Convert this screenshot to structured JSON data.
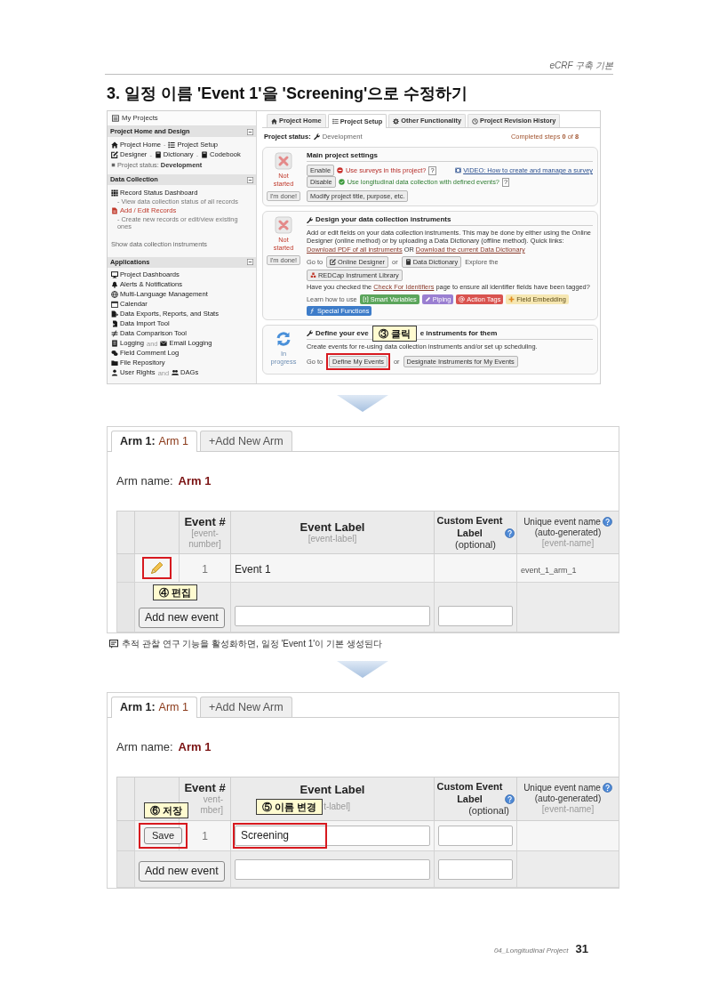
{
  "page_header": {
    "section": "eCRF 구축 기본"
  },
  "title": "3. 일정 이름 'Event 1'을 'Screening'으로 수정하기",
  "project_setup_screen": {
    "sidebar": {
      "heading": "My Projects",
      "sections": [
        {
          "title": "Project Home and Design",
          "expanded": true,
          "rows": [
            {
              "kind": "links",
              "parts": [
                {
                  "kind": "link",
                  "text": "Project Home"
                },
                {
                  "kind": "sep",
                  "text": "-"
                },
                {
                  "kind": "link",
                  "text": "Project Setup"
                }
              ]
            },
            {
              "kind": "links",
              "parts": [
                {
                  "kind": "link",
                  "text": "Designer"
                },
                {
                  "kind": "sep",
                  "text": "-"
                },
                {
                  "kind": "link",
                  "text": "Dictionary"
                },
                {
                  "kind": "sep",
                  "text": "-"
                },
                {
                  "kind": "link",
                  "text": "Codebook"
                }
              ]
            },
            {
              "kind": "status",
              "label": "Project status:",
              "value": "Development"
            }
          ]
        },
        {
          "title": "Data Collection",
          "expanded": true,
          "rows": [
            {
              "kind": "links",
              "parts": [
                {
                  "kind": "link",
                  "text": "Record Status Dashboard"
                }
              ]
            },
            {
              "kind": "hint",
              "text": "- View data collection status of all records"
            },
            {
              "kind": "links",
              "parts": [
                {
                  "kind": "link",
                  "text": "Add / Edit Records",
                  "color": "#c0392b"
                }
              ]
            },
            {
              "kind": "hint",
              "text": "- Create new records or edit/view existing ones"
            },
            {
              "kind": "plain",
              "text": "Show data collection instruments"
            }
          ]
        },
        {
          "title": "Applications",
          "expanded": true,
          "rows": [
            {
              "kind": "links",
              "parts": [
                {
                  "kind": "link",
                  "text": "Project Dashboards"
                }
              ]
            },
            {
              "kind": "links",
              "parts": [
                {
                  "kind": "link",
                  "text": "Alerts & Notifications"
                }
              ]
            },
            {
              "kind": "links",
              "parts": [
                {
                  "kind": "link",
                  "text": "Multi-Language Management"
                }
              ]
            },
            {
              "kind": "links",
              "parts": [
                {
                  "kind": "link",
                  "text": "Calendar"
                }
              ]
            },
            {
              "kind": "links",
              "parts": [
                {
                  "kind": "link",
                  "text": "Data Exports, Reports, and Stats"
                }
              ]
            },
            {
              "kind": "links",
              "parts": [
                {
                  "kind": "link",
                  "text": "Data Import Tool"
                }
              ]
            },
            {
              "kind": "links",
              "parts": [
                {
                  "kind": "link",
                  "text": "Data Comparison Tool"
                }
              ]
            },
            {
              "kind": "links",
              "parts": [
                {
                  "kind": "link",
                  "text": "Logging"
                },
                {
                  "kind": "sep",
                  "text": "and"
                },
                {
                  "kind": "link",
                  "text": "Email Logging"
                }
              ]
            },
            {
              "kind": "links",
              "parts": [
                {
                  "kind": "link",
                  "text": "Field Comment Log"
                }
              ]
            },
            {
              "kind": "links",
              "parts": [
                {
                  "kind": "link",
                  "text": "File Repository"
                }
              ]
            },
            {
              "kind": "links",
              "parts": [
                {
                  "kind": "link",
                  "text": "User Rights"
                },
                {
                  "kind": "sep",
                  "text": "and"
                },
                {
                  "kind": "link",
                  "text": "DAGs"
                }
              ]
            }
          ]
        }
      ]
    },
    "main": {
      "tabs": [
        {
          "label": "Project Home",
          "selected": false
        },
        {
          "label": "Project Setup",
          "selected": true
        },
        {
          "label": "Other Functionality",
          "selected": false
        },
        {
          "label": "Project Revision History",
          "selected": false
        }
      ],
      "status_line": {
        "label": "Project status:",
        "value": "Development",
        "progress": "Completed steps **0** of **8**"
      },
      "steps": [
        {
          "kind": "not_started",
          "status_text": "Not started",
          "done_button": "I'm done!",
          "title": "Main project settings",
          "rows": [
            {
              "kind": "option",
              "button": "Enable",
              "enabled": false,
              "text": "Use surveys in this project?",
              "help": "?",
              "link": "VIDEO: How to create and manage a survey"
            },
            {
              "kind": "option",
              "button": "Disable",
              "enabled": true,
              "text": "Use longitudinal data collection with defined events?",
              "help": "?"
            },
            {
              "kind": "actions",
              "parts": [
                {
                  "kind": "button",
                  "text": "Modify project title, purpose, etc.",
                  "highlighted": false
                }
              ]
            }
          ]
        },
        {
          "kind": "not_started",
          "status_text": "Not started",
          "done_button": "I'm done!",
          "title": "Design your data collection instruments",
          "rows": [
            {
              "kind": "paragraph",
              "parts": [
                {
                  "kind": "text",
                  "text": "Add or edit fields on your data collection instruments. This may be done by either using the Online Designer (online method) or by uploading a Data Dictionary (offline method). Quick links: "
                },
                {
                  "kind": "link",
                  "text": "Download PDF of all instruments"
                },
                {
                  "kind": "text",
                  "text": " OR "
                },
                {
                  "kind": "link",
                  "text": "Download the current Data Dictionary"
                }
              ]
            },
            {
              "kind": "actions",
              "parts": [
                {
                  "kind": "text",
                  "text": "Go to"
                },
                {
                  "kind": "button",
                  "text": "Online Designer",
                  "highlighted": false
                },
                {
                  "kind": "text",
                  "text": "or"
                },
                {
                  "kind": "button",
                  "text": "Data Dictionary",
                  "highlighted": false
                },
                {
                  "kind": "text",
                  "text": "Explore the"
                },
                {
                  "kind": "button",
                  "text": "REDCap Instrument Library",
                  "highlighted": false
                }
              ]
            },
            {
              "kind": "paragraph",
              "parts": [
                {
                  "kind": "text",
                  "text": "Have you checked the "
                },
                {
                  "kind": "link",
                  "text": "Check For Identifiers"
                },
                {
                  "kind": "text",
                  "text": " page to ensure all identifier fields have been tagged?"
                }
              ]
            },
            {
              "kind": "badges",
              "text": "Learn how to use",
              "badges": [
                {
                  "label": "Smart Variables",
                  "color": "#5ba55b"
                },
                {
                  "label": "Piping",
                  "color": "#9a7fd1"
                },
                {
                  "label": "Action Tags",
                  "color": "#d9534f"
                },
                {
                  "label": "Field Embedding",
                  "color": "#f6e7b2"
                },
                {
                  "label": "Special Functions",
                  "color": "#3d7cc9"
                }
              ]
            }
          ]
        },
        {
          "kind": "in_progress",
          "status_text": "In progress",
          "title_parts": [
            {
              "kind": "text",
              "text": "Define your eve"
            },
            {
              "kind": "callout",
              "text": "③ 클릭"
            },
            {
              "kind": "text",
              "text": "e instruments for them"
            }
          ],
          "rows": [
            {
              "kind": "paragraph",
              "parts": [
                {
                  "kind": "text",
                  "text": "Create events for re-using data collection instruments and/or set up scheduling."
                }
              ]
            },
            {
              "kind": "actions",
              "parts": [
                {
                  "kind": "text",
                  "text": "Go to"
                },
                {
                  "kind": "button",
                  "text": "Define My Events",
                  "highlighted": true
                },
                {
                  "kind": "text",
                  "text": "or"
                },
                {
                  "kind": "button",
                  "text": "Designate Instruments for My Events",
                  "highlighted": false
                }
              ]
            }
          ]
        }
      ]
    }
  },
  "define_events_screen": {
    "tabs": [
      {
        "prefix": "Arm 1:",
        "label": "Arm 1",
        "selected": true
      },
      {
        "label": "+Add New Arm",
        "selected": false
      }
    ],
    "arm_name": {
      "label": "Arm name:",
      "value": "Arm 1"
    },
    "columns": [
      {
        "kind": "blank"
      },
      {
        "kind": "blank"
      },
      {
        "kind": "heading",
        "title": "Event #",
        "notes": [
          {
            "kind": "hint",
            "text": "[event-number]"
          }
        ]
      },
      {
        "kind": "heading",
        "title": "Event Label",
        "notes": [
          {
            "kind": "hint",
            "text": "[event-label]"
          }
        ]
      },
      {
        "kind": "heading",
        "title": "Custom Event Label",
        "notes": [
          {
            "kind": "note",
            "text": "(optional)"
          }
        ]
      },
      {
        "kind": "heading",
        "title": "Unique event name",
        "notes": [
          {
            "kind": "note",
            "text": "(auto-generated)"
          },
          {
            "kind": "hint",
            "text": "[event-name]"
          }
        ]
      }
    ],
    "rows": [
      {
        "cells": [
          {
            "kind": "blank"
          },
          {
            "kind": "edit",
            "highlighted": true,
            "callout": "④ 편집"
          },
          {
            "kind": "text",
            "text": "1"
          },
          {
            "kind": "text",
            "text": "Event 1"
          },
          {
            "kind": "blank"
          },
          {
            "kind": "text",
            "text": "event_1_arm_1"
          }
        ]
      },
      {
        "cells": [
          {
            "kind": "blank"
          },
          {
            "kind": "button",
            "text": "Add new event",
            "highlighted": false,
            "colspan": 2
          },
          {
            "kind": "input",
            "highlighted": false
          },
          {
            "kind": "input",
            "highlighted": false
          },
          {
            "kind": "blank"
          }
        ]
      }
    ]
  },
  "caption": "추적 관찰 연구 기능을 활성화하면, 일정 'Event 1'이 기본 생성된다",
  "edit_events_screen": {
    "tabs": [
      {
        "prefix": "Arm 1:",
        "label": "Arm 1",
        "selected": true
      },
      {
        "label": "+Add New Arm",
        "selected": false
      }
    ],
    "arm_name": {
      "label": "Arm name:",
      "value": "Arm 1"
    },
    "columns": [
      {
        "kind": "blank"
      },
      {
        "kind": "blank",
        "callout": "⑥ 저장"
      },
      {
        "kind": "heading",
        "title": "Event #",
        "notes": [
          {
            "kind": "hint",
            "text": "vent-"
          },
          {
            "kind": "hint",
            "text": "mber]"
          }
        ]
      },
      {
        "kind": "heading",
        "title": "Event Label",
        "callout": "⑤ 이름 변경",
        "notes": [
          {
            "kind": "hint",
            "text": "t-label]"
          }
        ]
      },
      {
        "kind": "heading",
        "title": "Custom Event Label",
        "notes": [
          {
            "kind": "note",
            "text": "(optional)"
          }
        ]
      },
      {
        "kind": "heading",
        "title": "Unique event name",
        "notes": [
          {
            "kind": "note",
            "text": "(auto-generated)"
          },
          {
            "kind": "hint",
            "text": "[event-name]"
          }
        ]
      }
    ],
    "rows": [
      {
        "cells": [
          {
            "kind": "blank"
          },
          {
            "kind": "button",
            "text": "Save",
            "highlighted": true
          },
          {
            "kind": "text",
            "text": "1"
          },
          {
            "kind": "input",
            "value": "Screening",
            "highlighted": true
          },
          {
            "kind": "input",
            "highlighted": false
          },
          {
            "kind": "blank"
          }
        ]
      },
      {
        "cells": [
          {
            "kind": "blank"
          },
          {
            "kind": "button",
            "text": "Add new event",
            "highlighted": false,
            "colspan": 2
          },
          {
            "kind": "input",
            "highlighted": false
          },
          {
            "kind": "input",
            "highlighted": false
          },
          {
            "kind": "blank"
          }
        ]
      }
    ]
  },
  "footer": {
    "chapter": "04_Longitudinal Project",
    "page": "31"
  }
}
